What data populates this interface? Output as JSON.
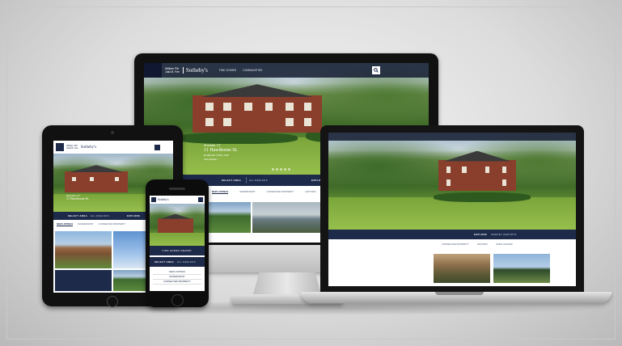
{
  "site": {
    "brand_line1": "William Pitt",
    "brand_line2": "Julia B. Fee",
    "brand_name": "Sotheby's",
    "nav": [
      "FIND HOMES",
      "COMMUNITIES"
    ],
    "hero_heading": "Riverside, CT",
    "hero_subheading": "11 Hawthorne St.",
    "hero_price": "$1,995,000 | 5 BD | 5 BA",
    "hero_link": "View Details >",
    "search_label": "SELECT AREA",
    "search_value": "All Regions",
    "explore_label": "EXPLORE",
    "explore_value": "Market Reports",
    "tabs": [
      "NEW LISTINGS",
      "WATERFRONT",
      "CONNECTED PROPERTY",
      "HISTORIC",
      "OPEN HOUSES"
    ],
    "phone_find": "FIND HOMES NEARBY",
    "phone_links": [
      "NEW LISTINGS",
      "WATERFRONT",
      "CONNECTED PROPERTY"
    ]
  },
  "colors": {
    "navy": "#1d2a4a",
    "brick": "#8a3f2c",
    "lawn": "#7aa53a"
  },
  "icons": [
    "search-icon",
    "share-icon",
    "menu-icon"
  ]
}
